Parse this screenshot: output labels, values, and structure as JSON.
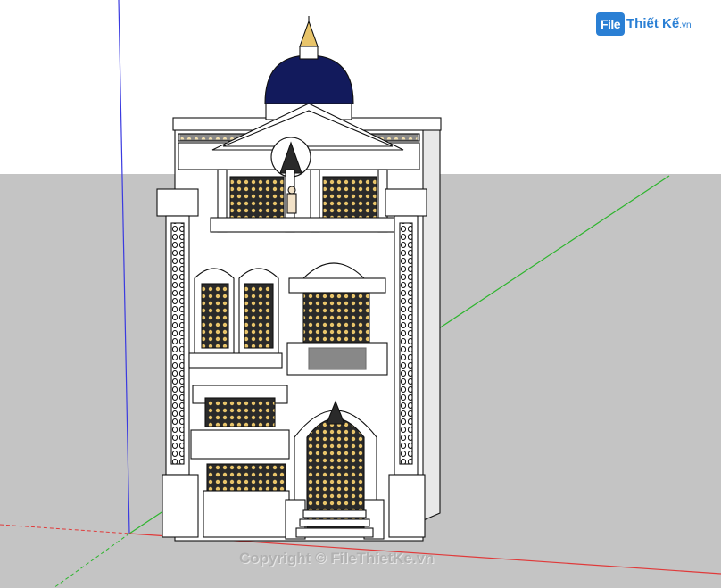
{
  "app": {
    "name": "SketchUp model viewport"
  },
  "watermark": {
    "logo_box": "File",
    "logo_name": "Thiết Kế",
    "logo_domain": ".vn",
    "copyright": "Copyright © FileThietKe.vn"
  },
  "colors": {
    "sky": "#ffffff",
    "ground": "#c4c4c4",
    "axis_red": "#e03a3a",
    "axis_green": "#2db52d",
    "axis_blue": "#3a3ae0",
    "dome": "#121a5c",
    "facade": "#ffffff",
    "window_glow": "#e8c46a",
    "logo_blue": "#2a7fd4",
    "logo_red": "#d4252a"
  },
  "icons": {
    "logo": "file-thiet-ke-logo",
    "model": "neoclassical-townhouse-model"
  }
}
